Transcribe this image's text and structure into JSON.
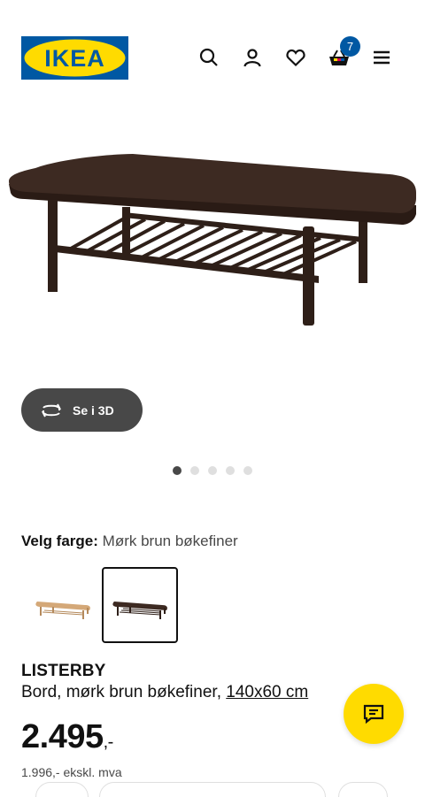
{
  "header": {
    "logo_text": "IKEA",
    "cart_count": "7",
    "icons": [
      "search-icon",
      "user-icon",
      "heart-icon",
      "cart-icon",
      "menu-icon"
    ]
  },
  "gallery": {
    "view_3d_label": "Se i 3D",
    "image_count": 5,
    "active_index": 0
  },
  "color_picker": {
    "label": "Velg farge:",
    "selected_value": "Mørk brun bøkefiner",
    "swatches": [
      "light-oak",
      "dark-brown"
    ],
    "selected_index": 1
  },
  "product": {
    "name": "LISTERBY",
    "description": "Bord, mørk brun bøkefiner,",
    "size": "140x60 cm",
    "price_main": "2.495",
    "price_decimal": ",-",
    "price_ex_vat": "1.996,- ekskl. mva"
  },
  "colors": {
    "ikea_blue": "#0058a3",
    "ikea_yellow": "#ffdb00",
    "dark_grey": "#484848",
    "table_brown": "#3d2a22"
  }
}
